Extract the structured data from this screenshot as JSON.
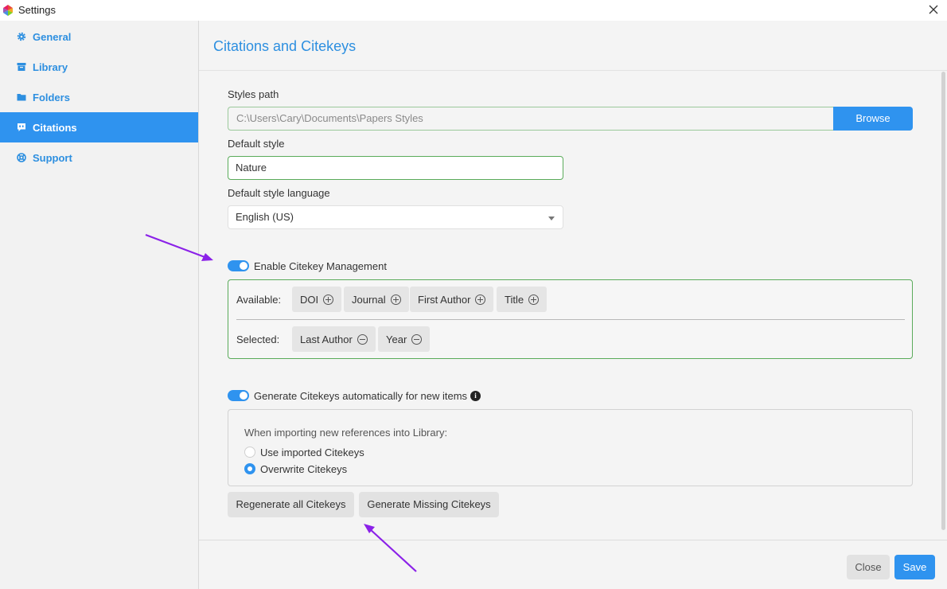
{
  "window": {
    "title": "Settings",
    "app_icon": "app-logo-icon",
    "close_icon": "close-icon"
  },
  "sidebar": {
    "items": [
      {
        "label": "General",
        "icon": "gear-icon",
        "active": false
      },
      {
        "label": "Library",
        "icon": "archive-icon",
        "active": false
      },
      {
        "label": "Folders",
        "icon": "folder-icon",
        "active": false
      },
      {
        "label": "Citations",
        "icon": "quote-bubble-icon",
        "active": true
      },
      {
        "label": "Support",
        "icon": "lifebuoy-icon",
        "active": false
      }
    ]
  },
  "main": {
    "title": "Citations and Citekeys",
    "styles_path": {
      "label": "Styles path",
      "value": "C:\\Users\\Cary\\Documents\\Papers Styles",
      "browse_label": "Browse"
    },
    "default_style": {
      "label": "Default style",
      "value": "Nature"
    },
    "default_style_language": {
      "label": "Default style language",
      "selected": "English (US)"
    },
    "citekey_management": {
      "toggle_label": "Enable Citekey Management",
      "enabled": true,
      "available_label": "Available:",
      "available": [
        "DOI",
        "Journal",
        "First Author",
        "Title"
      ],
      "selected_label": "Selected:",
      "selected": [
        "Last Author",
        "Year"
      ]
    },
    "auto_generate": {
      "toggle_label": "Generate Citekeys automatically for new items",
      "enabled": true,
      "prompt": "When importing new references into Library:",
      "options": [
        {
          "label": "Use imported Citekeys",
          "checked": false
        },
        {
          "label": "Overwrite Citekeys",
          "checked": true
        }
      ]
    },
    "actions": {
      "regenerate_label": "Regenerate all Citekeys",
      "generate_missing_label": "Generate Missing Citekeys"
    }
  },
  "footer": {
    "close_label": "Close",
    "save_label": "Save"
  },
  "colors": {
    "accent": "#2f93ef",
    "valid_border": "#5aab5a",
    "annotation_arrow": "#8b21e8"
  }
}
